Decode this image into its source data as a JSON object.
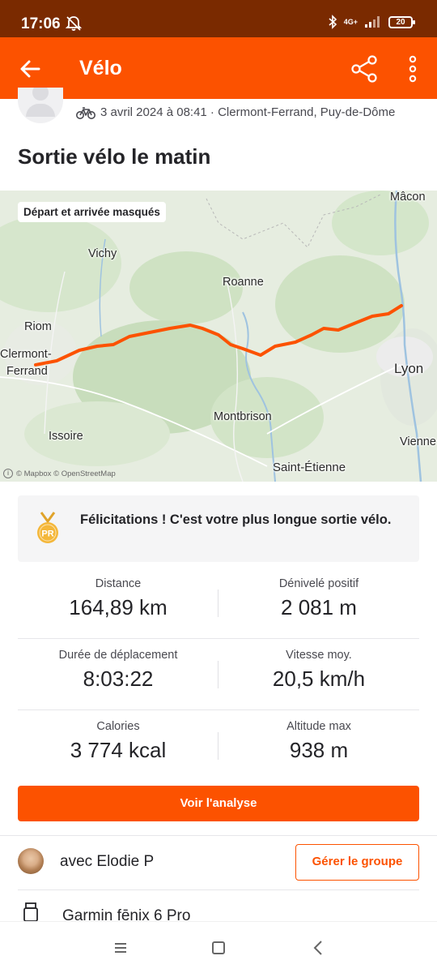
{
  "status_bar": {
    "time": "17:06",
    "network": "4G+",
    "battery": "20",
    "icons": [
      "mute-icon",
      "bluetooth-icon",
      "signal-icon",
      "battery-icon"
    ]
  },
  "app_bar": {
    "title": "Vélo",
    "icons": [
      "back-arrow-icon",
      "share-icon",
      "more-vertical-icon"
    ]
  },
  "activity": {
    "meta": "3 avril 2024 à 08:41 · Clermont-Ferrand, Puy-de-Dôme",
    "title": "Sortie vélo le matin"
  },
  "map": {
    "badge": "Départ et arrivée masqués",
    "labels": {
      "macon": "Mâcon",
      "vichy": "Vichy",
      "roanne": "Roanne",
      "riom": "Riom",
      "clermont_1": "Clermont-",
      "clermont_2": "Ferrand",
      "lyon": "Lyon",
      "montbrison": "Montbrison",
      "issoire": "Issoire",
      "vienne": "Vienne",
      "saint_etienne": "Saint-Étienne"
    },
    "attribution": "© Mapbox © OpenStreetMap",
    "route_color": "#fc5200"
  },
  "achievement": {
    "text": "Félicitations ! C'est votre plus longue sortie vélo.",
    "badge": "PR"
  },
  "stats": [
    [
      {
        "label": "Distance",
        "value": "164,89 km"
      },
      {
        "label": "Dénivelé positif",
        "value": "2 081 m"
      }
    ],
    [
      {
        "label": "Durée de déplacement",
        "value": "8:03:22"
      },
      {
        "label": "Vitesse moy.",
        "value": "20,5 km/h"
      }
    ],
    [
      {
        "label": "Calories",
        "value": "3 774 kcal"
      },
      {
        "label": "Altitude max",
        "value": "938 m"
      }
    ]
  ],
  "cta": {
    "label": "Voir l'analyse"
  },
  "group": {
    "text": "avec Elodie P",
    "button": "Gérer le groupe"
  },
  "device": {
    "text": "Garmin fēnix 6 Pro"
  },
  "nav_bar": {
    "icons": [
      "recents-icon",
      "home-icon",
      "back-icon"
    ]
  },
  "colors": {
    "accent": "#fc5200",
    "status_bar": "#7a2a00"
  }
}
